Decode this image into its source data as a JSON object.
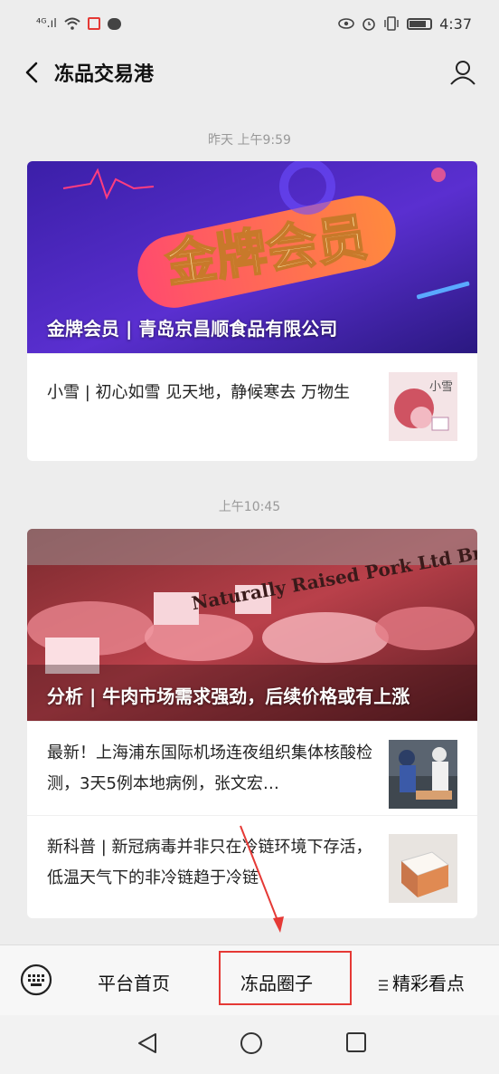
{
  "status_bar": {
    "signal_text": "⁴ᴳ.ıl",
    "time": "4:37"
  },
  "header": {
    "title": "冻品交易港"
  },
  "messages": [
    {
      "timestamp": "昨天 上午9:59",
      "banner_art_text": "金牌会员",
      "banner_title": "金牌会员 | 青岛京昌顺食品有限公司",
      "items": [
        {
          "text": "小雪 | 初心如雪 见天地，静候寒去 万物生",
          "thumb_icon": "xiaoxue-thumbnail",
          "thumb_text": "小雪"
        }
      ]
    },
    {
      "timestamp": "上午10:45",
      "banner_art_text": "Naturally Raised Pork Ltd Bre",
      "banner_title": "分析 | 牛肉市场需求强劲，后续价格或有上涨",
      "items": [
        {
          "text": "最新！上海浦东国际机场连夜组织集体核酸检测，3天5例本地病例，张文宏…",
          "thumb_icon": "testing-thumbnail"
        },
        {
          "text": "新科普 | 新冠病毒并非只在冷链环境下存活，低温天气下的非冷链趋于冷链",
          "thumb_icon": "box-thumbnail"
        }
      ]
    }
  ],
  "menu": {
    "items": [
      "平台首页",
      "冻品圈子",
      "精彩看点"
    ],
    "highlighted_index": 1,
    "highlight_color": "#e53935"
  },
  "colors": {
    "background": "#ededed",
    "annotation_red": "#e53935"
  }
}
